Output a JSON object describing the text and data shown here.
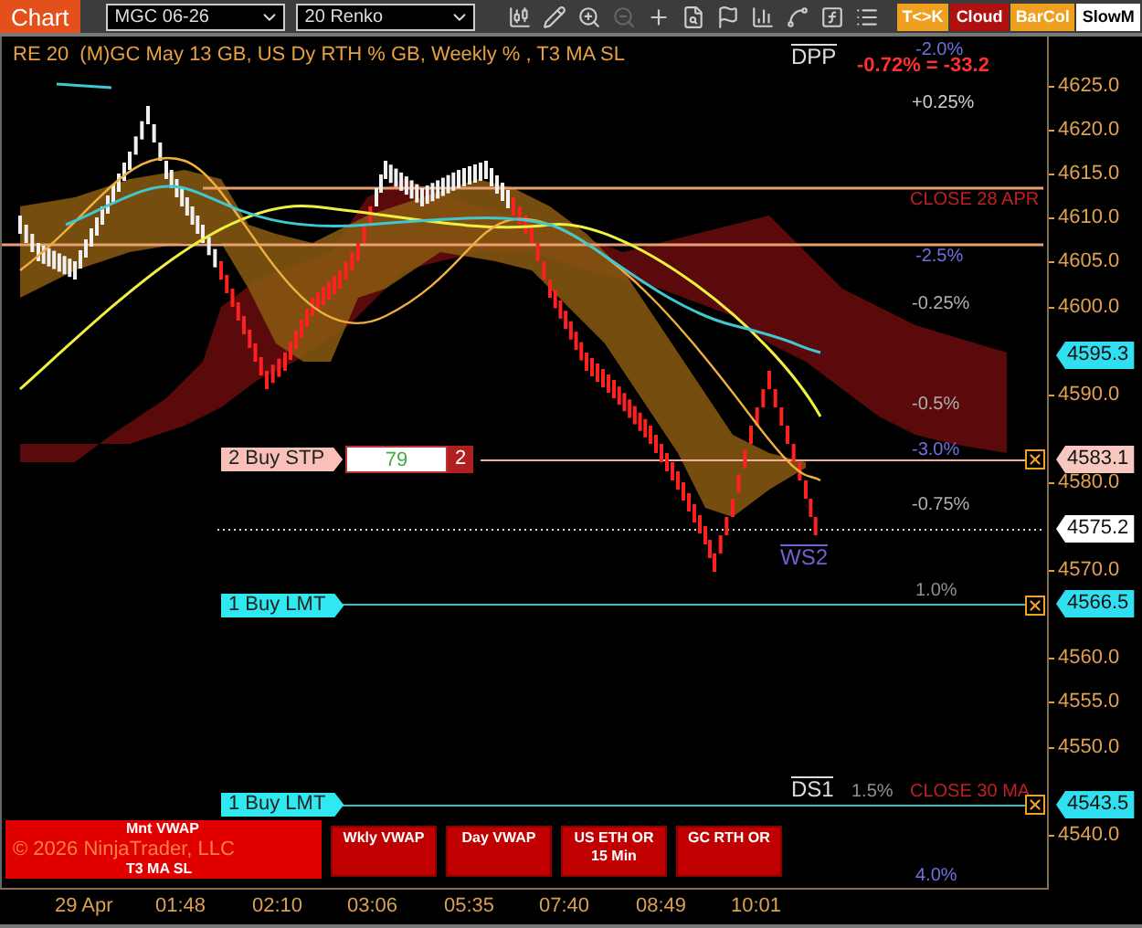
{
  "toolbar": {
    "app_button": "Chart",
    "instrument": "MGC 06-26",
    "bar_type": "20 Renko",
    "buttons": [
      {
        "label": "T<>K",
        "color": "#f0a020"
      },
      {
        "label": "Cloud",
        "color": "#b01010"
      },
      {
        "label": "BarCol",
        "color": "#f0a020"
      },
      {
        "label": "SlowM",
        "color": "#ffffff"
      }
    ]
  },
  "chart": {
    "title": "RE 20  (M)GC May 13 GB, US Dy RTH % GB, Weekly % , T3 MA SL",
    "level_labels": [
      "DPP",
      "WS2",
      "DS1"
    ],
    "percent_labels": [
      {
        "text": "-2.0%",
        "color": "#7070e0"
      },
      {
        "text": "-0.72% = -33.2",
        "color": "#ff3030"
      },
      {
        "text": "+0.25%",
        "color": "#d0d0d0"
      },
      {
        "text": "CLOSE 28 APR",
        "color": "#c02020"
      },
      {
        "text": "-2.5%",
        "color": "#7070e0"
      },
      {
        "text": "-0.25%",
        "color": "#b0b0b0"
      },
      {
        "text": "-0.5%",
        "color": "#b0b0b0"
      },
      {
        "text": "-3.0%",
        "color": "#7070e0"
      },
      {
        "text": "-0.75%",
        "color": "#b0b0b0"
      },
      {
        "text": "1.0%",
        "color": "#909090"
      },
      {
        "text": "1.5%",
        "color": "#909090"
      },
      {
        "text": "CLOSE 30 MA",
        "color": "#c02020"
      },
      {
        "text": "4.0%",
        "color": "#7070e0"
      }
    ],
    "orders": [
      {
        "label": "2 Buy STP",
        "kind": "stop",
        "quantity": "79",
        "count": "2"
      },
      {
        "label": "1 Buy LMT",
        "kind": "limit"
      },
      {
        "label": "1 Buy LMT",
        "kind": "limit"
      }
    ],
    "indicator_panel": {
      "top": "Mnt VWAP",
      "bottom": "T3 MA SL",
      "copyright": "© 2026 NinjaTrader, LLC"
    },
    "indicator_buttons": [
      "Wkly VWAP",
      "Day VWAP",
      "US ETH OR 15 Min",
      "GC RTH OR"
    ]
  },
  "price_axis": {
    "ticks": [
      "4625.0",
      "4620.0",
      "4615.0",
      "4610.0",
      "4605.0",
      "4600.0",
      "4590.0",
      "4580.0",
      "4570.0",
      "4560.0",
      "4555.0",
      "4550.0",
      "4540.0"
    ],
    "markers": [
      {
        "text": "4595.3",
        "color": "#30e0f0"
      },
      {
        "text": "4583.1",
        "color": "#f8c8c0"
      },
      {
        "text": "4575.2",
        "color": "#ffffff"
      },
      {
        "text": "4566.5",
        "color": "#30e0f0"
      },
      {
        "text": "4543.5",
        "color": "#30e0f0"
      }
    ]
  },
  "time_axis": {
    "labels": [
      "29 Apr",
      "01:48",
      "02:10",
      "03:06",
      "05:35",
      "07:40",
      "08:49",
      "10:01"
    ]
  }
}
